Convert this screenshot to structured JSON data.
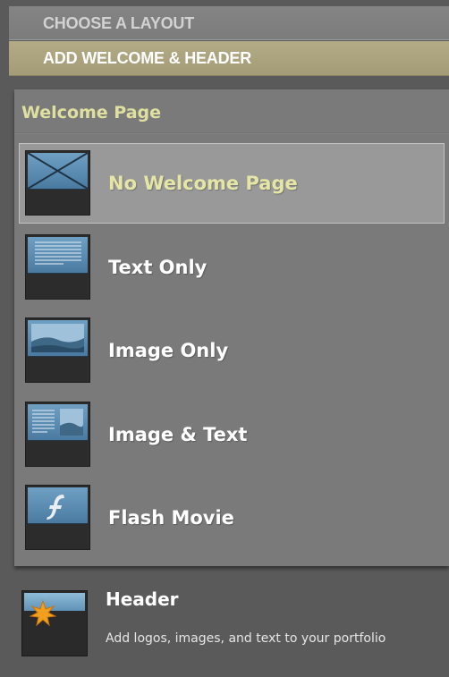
{
  "steps": {
    "choose_layout": "CHOOSE A LAYOUT",
    "add_welcome_header": "ADD WELCOME & HEADER"
  },
  "welcome": {
    "title": "Welcome Page",
    "options": [
      {
        "label": "No Welcome Page",
        "icon": "no-welcome-icon",
        "selected": true
      },
      {
        "label": "Text Only",
        "icon": "text-only-icon",
        "selected": false
      },
      {
        "label": "Image Only",
        "icon": "image-only-icon",
        "selected": false
      },
      {
        "label": "Image & Text",
        "icon": "image-text-icon",
        "selected": false
      },
      {
        "label": "Flash Movie",
        "icon": "flash-movie-icon",
        "selected": false
      }
    ]
  },
  "header": {
    "title": "Header",
    "description": "Add logos, images, and text to your portfolio",
    "icon": "header-star-icon"
  },
  "colors": {
    "accent_label": "#e5e6a6",
    "active_step": "#aaa27c"
  }
}
